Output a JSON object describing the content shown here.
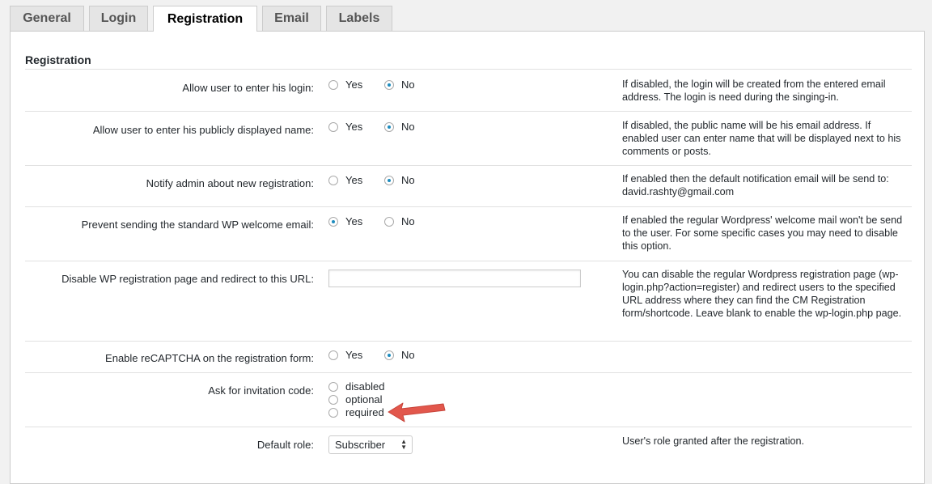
{
  "tabs": [
    {
      "label": "General"
    },
    {
      "label": "Login"
    },
    {
      "label": "Registration"
    },
    {
      "label": "Email"
    },
    {
      "label": "Labels"
    }
  ],
  "section": {
    "title": "Registration"
  },
  "rows": [
    {
      "label": "Allow user to enter his login:",
      "options": [
        "Yes",
        "No"
      ],
      "selected": "No",
      "description": "If disabled, the login will be created from the entered email address. The login is need during the singing-in."
    },
    {
      "label": "Allow user to enter his publicly displayed name:",
      "options": [
        "Yes",
        "No"
      ],
      "selected": "No",
      "description": "If disabled, the public name will be his email address. If enabled user can enter name that will be displayed next to his comments or posts."
    },
    {
      "label": "Notify admin about new registration:",
      "options": [
        "Yes",
        "No"
      ],
      "selected": "No",
      "description": "If enabled then the default notification email will be send to: david.rashty@gmail.com"
    },
    {
      "label": "Prevent sending the standard WP welcome email:",
      "options": [
        "Yes",
        "No"
      ],
      "selected": "Yes",
      "description": "If enabled the regular Wordpress' welcome mail won't be send to the user. For some specific cases you may need to disable this option."
    },
    {
      "label": "Disable WP registration page and redirect to this URL:",
      "input_value": "",
      "description": "You can disable the regular Wordpress registration page (wp-login.php?action=register) and redirect users to the specified URL address where they can find the CM Registration form/shortcode. Leave blank to enable the wp-login.php page."
    },
    {
      "label": "Enable reCAPTCHA on the registration form:",
      "options": [
        "Yes",
        "No"
      ],
      "selected": "No",
      "description": ""
    },
    {
      "label": "Ask for invitation code:",
      "options": [
        "disabled",
        "optional",
        "required"
      ],
      "selected": "",
      "description": ""
    },
    {
      "label": "Default role:",
      "select_value": "Subscriber",
      "description": "User's role granted after the registration."
    }
  ],
  "annotation": {
    "arrow_color": "#e2574c"
  }
}
